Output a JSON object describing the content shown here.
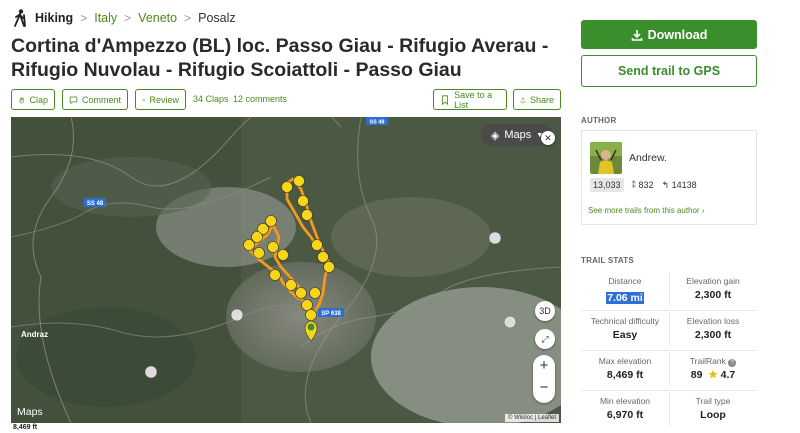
{
  "breadcrumb": {
    "root": "Hiking",
    "items": [
      "Italy",
      "Veneto"
    ],
    "current": "Posalz",
    "separator": ">"
  },
  "title": "Cortina d'Ampezzo (BL) loc. Passo Giau - Rifugio Averau - Rifugio Nuvolau - Rifugio Scoiattoli - Passo Giau",
  "actions": {
    "clap": "Clap",
    "comment": "Comment",
    "review": "Review",
    "claps_count": "34 Claps",
    "comments_count": "12 comments",
    "save": "Save to a List",
    "share": "Share"
  },
  "map": {
    "type_selector": "Maps",
    "btn_3d": "3D",
    "zoom_in": "+",
    "zoom_out": "−",
    "logo": "Maps",
    "attribution": "© Wikiloc | Leaflet",
    "road_labels": [
      "SS 48",
      "SS 48",
      "SP 638"
    ],
    "place_label": "Andraz",
    "elevation_note": "8,469 ft"
  },
  "sidebar": {
    "download": "Download",
    "send_gps": "Send trail to GPS",
    "author_label": "AUTHOR",
    "author_name": "Andrew.",
    "author_rank": "13,033",
    "author_trails": "832",
    "author_followers": "14138",
    "author_more": "See more trails from this author ›",
    "stats_label": "TRAIL STATS",
    "stats": [
      {
        "label": "Distance",
        "value": "7.06 mi"
      },
      {
        "label": "Elevation gain",
        "value": "2,300 ft"
      },
      {
        "label": "Technical difficulty",
        "value": "Easy"
      },
      {
        "label": "Elevation loss",
        "value": "2,300 ft"
      },
      {
        "label": "Max elevation",
        "value": "8,469 ft"
      },
      {
        "label": "TrailRank",
        "value": "89",
        "rating": "4.7"
      },
      {
        "label": "Min elevation",
        "value": "6,970 ft"
      },
      {
        "label": "Trail type",
        "value": "Loop"
      }
    ]
  },
  "colors": {
    "brand_green": "#3a8e2b",
    "link_green": "#4a8a1c",
    "trail_orange": "#f39a1e",
    "marker_yellow": "#f7d61a",
    "selection_blue": "#2f6fd6"
  }
}
